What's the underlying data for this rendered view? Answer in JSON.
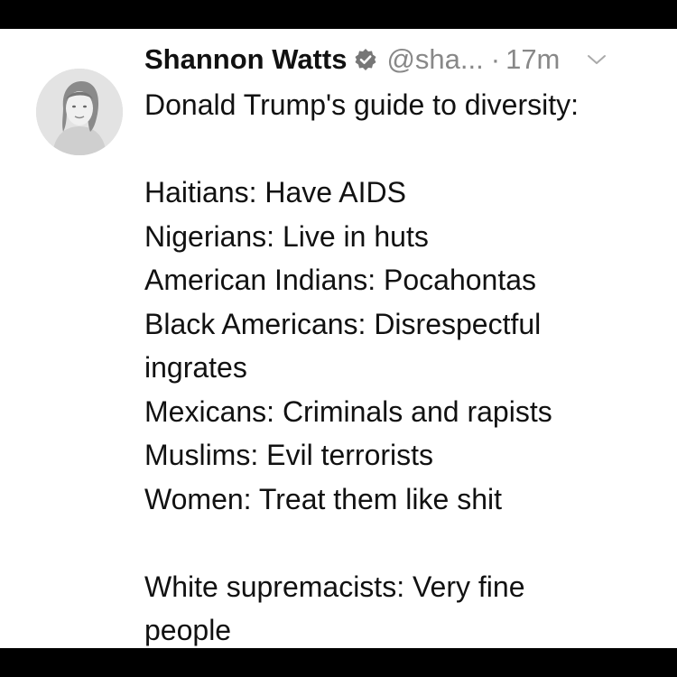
{
  "tweet": {
    "author_name": "Shannon Watts",
    "handle": "@sha...",
    "separator": "·",
    "time": "17m",
    "lines": [
      "Donald Trump's guide to diversity:",
      "",
      "Haitians: Have AIDS",
      "Nigerians: Live in huts",
      "American Indians: Pocahontas",
      "Black Americans: Disrespectful",
      "ingrates",
      "Mexicans: Criminals and rapists",
      "Muslims: Evil terrorists",
      "Women: Treat them like shit",
      "",
      "White supremacists: Very fine",
      "people"
    ]
  },
  "icons": {
    "verified": "verified-badge-icon",
    "menu": "chevron-down-icon",
    "avatar": "profile-photo"
  },
  "colors": {
    "frame": "#000000",
    "background": "#ffffff",
    "text": "#111111",
    "muted": "#888888"
  }
}
